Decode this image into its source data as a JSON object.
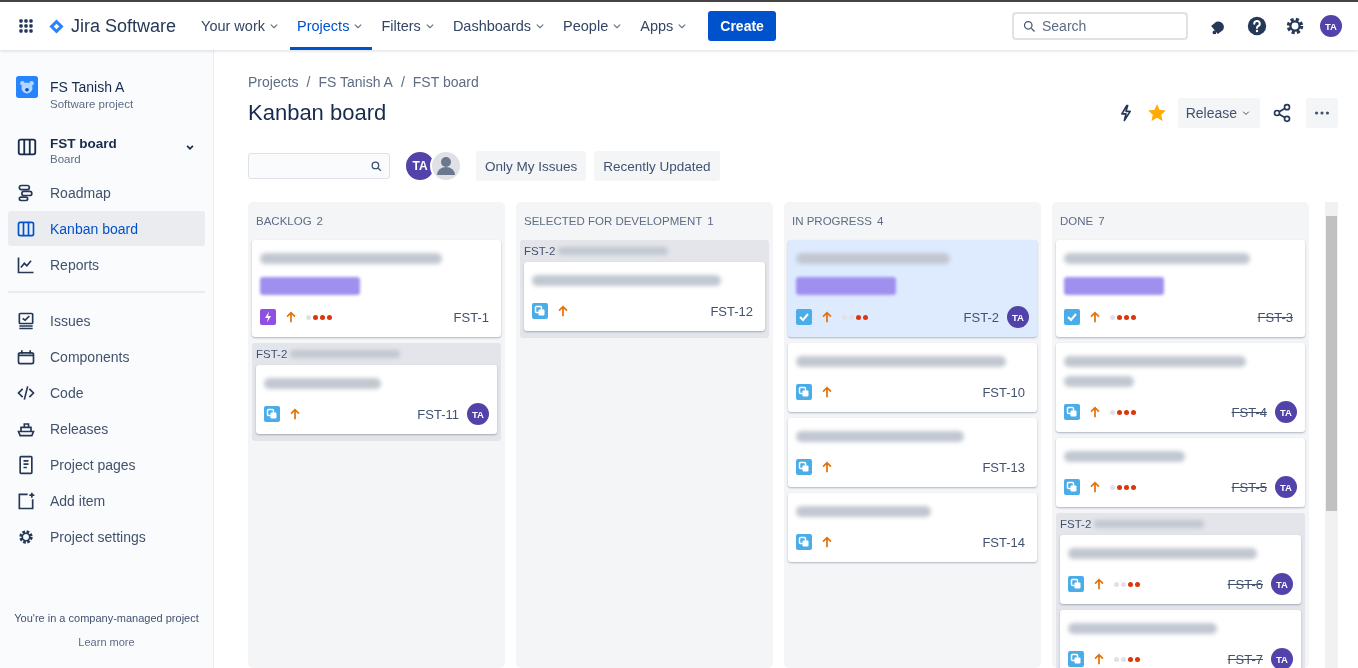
{
  "nav": {
    "product": "Jira Software",
    "items": [
      {
        "label": "Your work",
        "selected": false
      },
      {
        "label": "Projects",
        "selected": true
      },
      {
        "label": "Filters",
        "selected": false
      },
      {
        "label": "Dashboards",
        "selected": false
      },
      {
        "label": "People",
        "selected": false
      },
      {
        "label": "Apps",
        "selected": false
      }
    ],
    "create": "Create",
    "search": {
      "placeholder": "Search"
    },
    "avatar": "TA"
  },
  "sidebar": {
    "project": {
      "name": "FS Tanish A",
      "type": "Software project"
    },
    "board": {
      "name": "FST board",
      "type": "Board"
    },
    "planning": [
      {
        "label": "Roadmap",
        "kind": "roadmap",
        "selected": false
      },
      {
        "label": "Kanban board",
        "kind": "board",
        "selected": true
      },
      {
        "label": "Reports",
        "kind": "reports",
        "selected": false
      }
    ],
    "development": [
      {
        "label": "Issues",
        "kind": "issues",
        "selected": false
      },
      {
        "label": "Components",
        "kind": "components",
        "selected": false
      },
      {
        "label": "Code",
        "kind": "code",
        "selected": false
      },
      {
        "label": "Releases",
        "kind": "releases",
        "selected": false
      },
      {
        "label": "Project pages",
        "kind": "pages",
        "selected": false
      },
      {
        "label": "Add item",
        "kind": "add",
        "selected": false
      },
      {
        "label": "Project settings",
        "kind": "settings",
        "selected": false
      }
    ],
    "footer": "You're in a company-managed project",
    "link": "Learn more"
  },
  "breadcrumbs": {
    "separator": "/",
    "items": [
      "Projects",
      "FS Tanish A",
      "FST board"
    ]
  },
  "title": "Kanban board",
  "starred": true,
  "release": "Release",
  "filters": {
    "avatar": "TA",
    "buttons": [
      "Only My Issues",
      "Recently Updated"
    ]
  },
  "columns": [
    {
      "name": "BACKLOG",
      "count": "2",
      "items": [
        {
          "kind": "epic",
          "key": "FST-1",
          "label": true,
          "level": 0.75,
          "done": false,
          "selected": false
        },
        {
          "kind": "group",
          "key": "FST-2",
          "cards": [
            {
              "kind": "subtask",
              "key": "FST-11",
              "assignee": "TA",
              "done": false,
              "selected": false
            }
          ]
        }
      ]
    },
    {
      "name": "SELECTED FOR DEVELOPMENT",
      "count": "1",
      "items": [
        {
          "kind": "group",
          "key": "FST-2",
          "cards": [
            {
              "kind": "subtask",
              "key": "FST-12",
              "done": false,
              "selected": false
            }
          ]
        }
      ]
    },
    {
      "name": "IN PROGRESS",
      "count": "4",
      "items": [
        {
          "kind": "task",
          "key": "FST-2",
          "label": true,
          "level": 0.5,
          "assignee": "TA",
          "done": false,
          "selected": true
        },
        {
          "kind": "subtask",
          "key": "FST-10",
          "done": false,
          "selected": false
        },
        {
          "kind": "subtask",
          "key": "FST-13",
          "done": false,
          "selected": false
        },
        {
          "kind": "subtask",
          "key": "FST-14",
          "done": false,
          "selected": false
        }
      ]
    },
    {
      "name": "DONE",
      "count": "7",
      "items": [
        {
          "kind": "task",
          "key": "FST-3",
          "label": true,
          "level": 0.75,
          "done": true,
          "selected": false
        },
        {
          "kind": "subtask",
          "key": "FST-4",
          "long_title": true,
          "level": 0.75,
          "assignee": "TA",
          "done": true,
          "selected": false
        },
        {
          "kind": "subtask",
          "key": "FST-5",
          "level": 0.75,
          "assignee": "TA",
          "done": true,
          "selected": false
        },
        {
          "kind": "group",
          "key": "FST-2",
          "cards": [
            {
              "kind": "subtask",
              "key": "FST-6",
              "level": 0.5,
              "assignee": "TA",
              "done": true,
              "selected": false
            },
            {
              "kind": "subtask",
              "key": "FST-7",
              "level": 0.5,
              "assignee": "TA",
              "done": true,
              "selected": false
            }
          ]
        }
      ]
    }
  ]
}
